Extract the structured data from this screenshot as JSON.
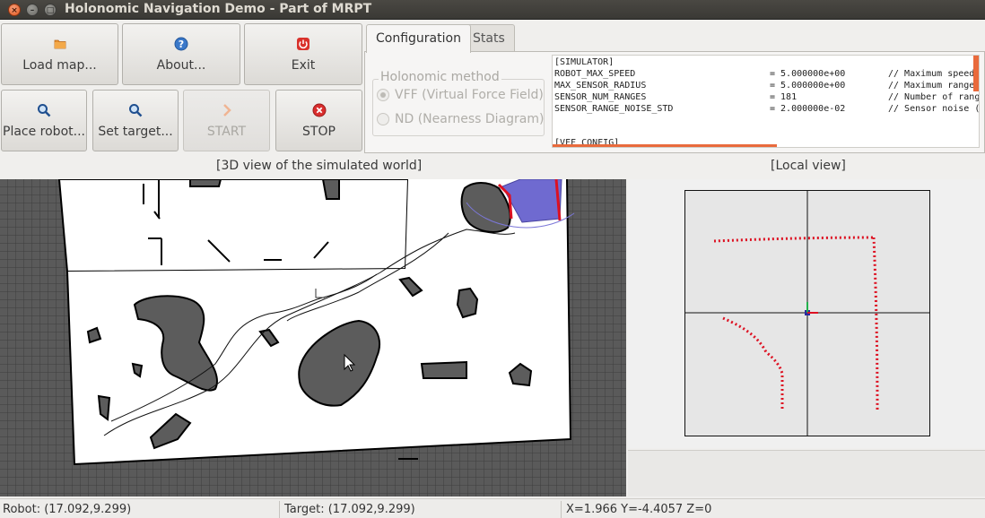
{
  "window": {
    "title": "Holonomic Navigation Demo - Part of MRPT"
  },
  "toolbar": {
    "load_map": "Load map...",
    "about": "About...",
    "exit": "Exit",
    "place_robot": "Place robot...",
    "set_target": "Set target...",
    "start": "START",
    "stop": "STOP"
  },
  "tabs": {
    "configuration": "Configuration",
    "stats": "Stats"
  },
  "holonomic": {
    "title": "Holonomic method",
    "options": [
      "VFF (Virtual Force Field)",
      "ND (Nearness  Diagram)"
    ],
    "selected": "VFF (Virtual Force Field)"
  },
  "config": {
    "section": "[SIMULATOR]",
    "rows": [
      {
        "key": "ROBOT_MAX_SPEED",
        "value": "= 5.000000e+00",
        "comment": "// Maximum speed"
      },
      {
        "key": "MAX_SENSOR_RADIUS",
        "value": "= 5.000000e+00",
        "comment": "// Maximum range"
      },
      {
        "key": "SENSOR_NUM_RANGES",
        "value": "= 181",
        "comment": "// Number of range"
      },
      {
        "key": "SENSOR_RANGE_NOISE_STD",
        "value": "= 2.000000e-02",
        "comment": "// Sensor noise (c"
      }
    ],
    "next_section": "[VFF_CONFIG]"
  },
  "views": {
    "world_label": "[3D view of the simulated world]",
    "local_label": "[Local view]"
  },
  "status": {
    "robot": "Robot: (17.092,9.299)",
    "target": "Target: (17.092,9.299)",
    "coords": "X=1.966 Y=-4.4057 Z=0"
  },
  "colors": {
    "obstacle": "#5c5c5c",
    "laser_points": "#dd1122",
    "sensor_area": "#6f6ad0",
    "accent": "#e96a3c"
  }
}
